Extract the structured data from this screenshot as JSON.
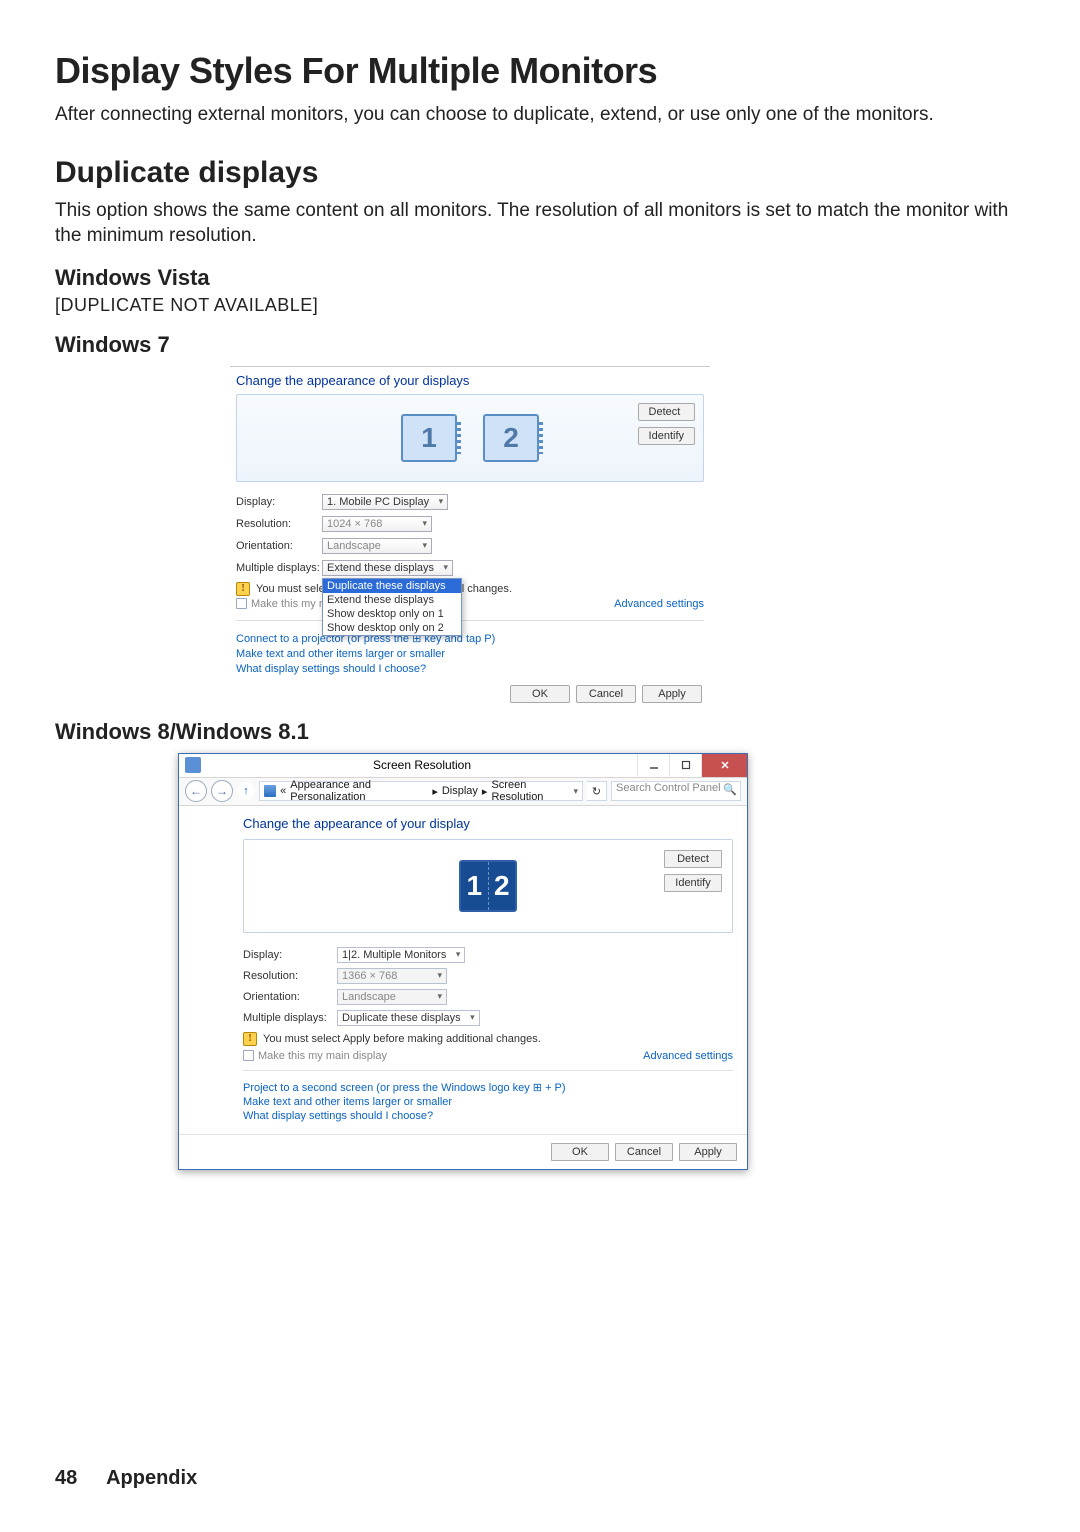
{
  "doc": {
    "h1": "Display Styles For Multiple Monitors",
    "intro": "After connecting external monitors, you can choose to duplicate, extend, or use only one of the monitors.",
    "h2": "Duplicate displays",
    "dup_desc": "This option shows the same content on all monitors. The resolution of all monitors is set to match the monitor with the minimum resolution.",
    "vista_h": "Windows Vista",
    "vista_note": "[DUPLICATE NOT AVAILABLE]",
    "w7_h": "Windows 7",
    "w8_h": "Windows 8/Windows 8.1",
    "page_num": "48",
    "section": "Appendix"
  },
  "win7": {
    "title": "Change the appearance of your displays",
    "detect": "Detect",
    "identify": "Identify",
    "display_lbl": "Display:",
    "display_val": "1. Mobile PC Display",
    "res_lbl": "Resolution:",
    "res_val": "1024 × 768",
    "orient_lbl": "Orientation:",
    "orient_val": "Landscape",
    "mult_lbl": "Multiple displays:",
    "mult_val": "Extend these displays",
    "dd_options": [
      "Duplicate these displays",
      "Extend these displays",
      "Show desktop only on 1",
      "Show desktop only on 2"
    ],
    "warn_prefix": "You must select",
    "warn_suffix": "onal changes.",
    "make_main": "Make this my m",
    "advanced": "Advanced settings",
    "proj_pre": "Connect to a projector (or press the ",
    "proj_post": " key and tap P)",
    "link2": "Make text and other items larger or smaller",
    "link3": "What display settings should I choose?",
    "ok": "OK",
    "cancel": "Cancel",
    "apply": "Apply"
  },
  "win8": {
    "win_title": "Screen Resolution",
    "bc_parts": [
      "«",
      "Appearance and Personalization",
      "▸",
      "Display",
      "▸",
      "Screen Resolution"
    ],
    "search_ph": "Search Control Panel",
    "title": "Change the appearance of your display",
    "detect": "Detect",
    "identify": "Identify",
    "display_lbl": "Display:",
    "display_val": "1|2. Multiple Monitors",
    "res_lbl": "Resolution:",
    "res_val": "1366 × 768",
    "orient_lbl": "Orientation:",
    "orient_val": "Landscape",
    "mult_lbl": "Multiple displays:",
    "mult_val": "Duplicate these displays",
    "warn": "You must select Apply before making additional changes.",
    "make_main": "Make this my main display",
    "advanced": "Advanced settings",
    "proj": "Project to a second screen (or press the Windows logo key ⊞ + P)",
    "link2": "Make text and other items larger or smaller",
    "link3": "What display settings should I choose?",
    "ok": "OK",
    "cancel": "Cancel",
    "apply": "Apply"
  }
}
